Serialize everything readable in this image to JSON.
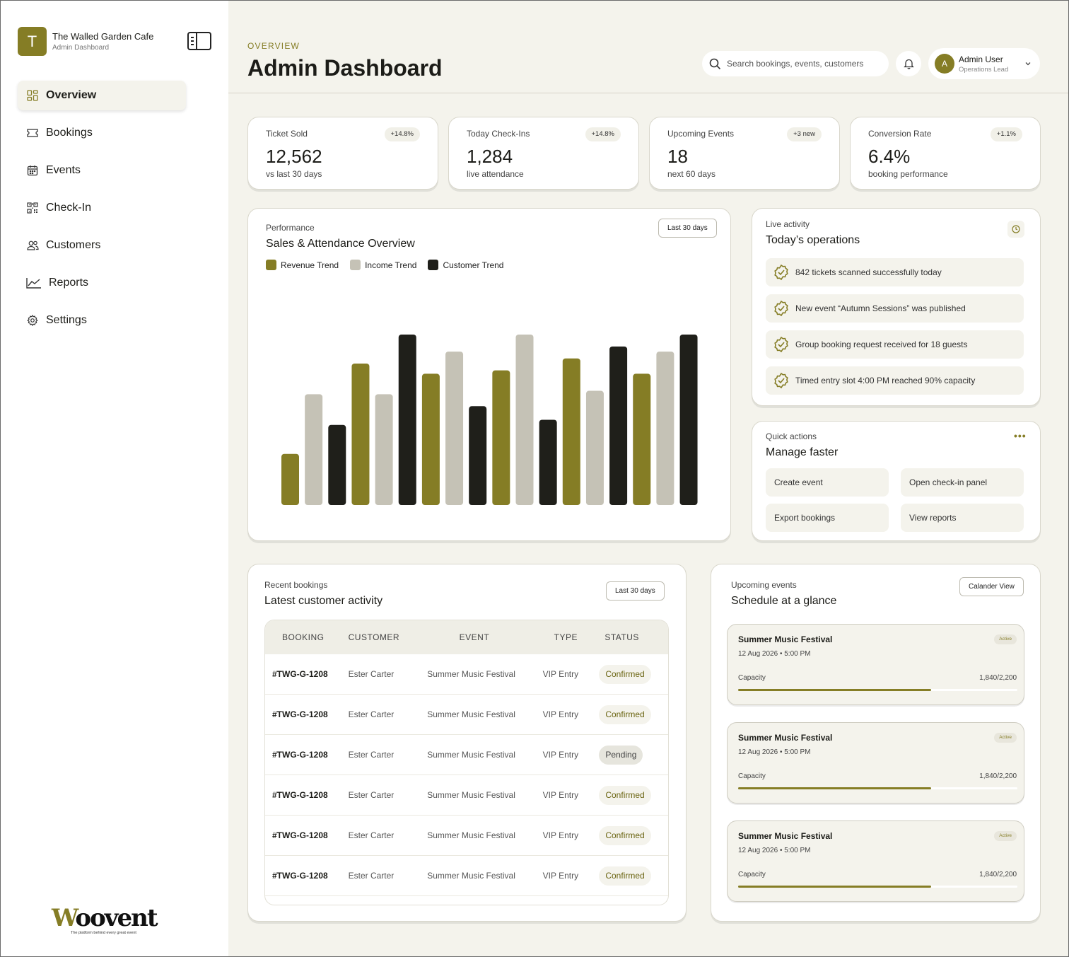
{
  "brand": {
    "initial": "T",
    "name": "The Walled Garden Cafe",
    "subtitle": "Admin Dashboard"
  },
  "sidebar": {
    "items": [
      {
        "label": "Overview",
        "icon": "grid-icon",
        "active": true
      },
      {
        "label": "Bookings",
        "icon": "ticket-icon"
      },
      {
        "label": "Events",
        "icon": "calendar-icon"
      },
      {
        "label": "Check-In",
        "icon": "qr-code-icon"
      },
      {
        "label": "Customers",
        "icon": "users-icon"
      },
      {
        "label": "Reports",
        "icon": "line-chart-icon"
      },
      {
        "label": "Settings",
        "icon": "gear-icon"
      }
    ],
    "footer_logo": {
      "word": "Woovent",
      "tagline": "The platform behind every great event"
    }
  },
  "header": {
    "eyebrow": "OVERVIEW",
    "title": "Admin Dashboard",
    "search_placeholder": "Search bookings, events, customers",
    "user": {
      "initial": "A",
      "name": "Admin User",
      "role": "Operations Lead"
    }
  },
  "stats": [
    {
      "label": "Ticket Sold",
      "badge": "+14.8%",
      "value": "12,562",
      "sub": "vs last 30 days"
    },
    {
      "label": "Today Check-Ins",
      "badge": "+14.8%",
      "value": "1,284",
      "sub": "live attendance"
    },
    {
      "label": "Upcoming Events",
      "badge": "+3 new",
      "value": "18",
      "sub": "next 60 days"
    },
    {
      "label": "Conversion Rate",
      "badge": "+1.1%",
      "value": "6.4%",
      "sub": "booking performance"
    }
  ],
  "performance": {
    "label": "Performance",
    "title": "Sales & Attendance Overview",
    "range_button": "Last 30 days"
  },
  "chart_data": {
    "type": "bar",
    "grid": false,
    "ylim": [
      0,
      100
    ],
    "legend_position": "top-left",
    "series": [
      {
        "name": "Revenue Trend",
        "color": "#857d25"
      },
      {
        "name": "Income Trend",
        "color": "#c5c2b6"
      },
      {
        "name": "Customer Trend",
        "color": "#1f1f1a"
      }
    ],
    "bars": [
      {
        "series": 0,
        "value": 30
      },
      {
        "series": 1,
        "value": 65
      },
      {
        "series": 2,
        "value": 47
      },
      {
        "series": 0,
        "value": 83
      },
      {
        "series": 1,
        "value": 65
      },
      {
        "series": 2,
        "value": 100
      },
      {
        "series": 0,
        "value": 77
      },
      {
        "series": 1,
        "value": 90
      },
      {
        "series": 2,
        "value": 58
      },
      {
        "series": 0,
        "value": 79
      },
      {
        "series": 1,
        "value": 100
      },
      {
        "series": 2,
        "value": 50
      },
      {
        "series": 0,
        "value": 86
      },
      {
        "series": 1,
        "value": 67
      },
      {
        "series": 2,
        "value": 93
      },
      {
        "series": 0,
        "value": 77
      },
      {
        "series": 1,
        "value": 90
      },
      {
        "series": 2,
        "value": 100
      }
    ]
  },
  "live_activity": {
    "label": "Live activity",
    "title": "Today’s operations",
    "items": [
      "842 tickets scanned successfully today",
      "New event “Autumn Sessions” was published",
      "Group booking request received for 18 guests",
      "Timed entry slot 4:00 PM reached 90% capacity"
    ]
  },
  "quick_actions": {
    "label": "Quick actions",
    "title": "Manage faster",
    "actions": [
      "Create event",
      "Open check-in panel",
      "Export bookings",
      "View reports"
    ]
  },
  "recent_bookings": {
    "label": "Recent bookings",
    "title": "Latest customer activity",
    "range_button": "Last 30 days",
    "columns": [
      "BOOKING",
      "CUSTOMER",
      "EVENT",
      "TYPE",
      "STATUS"
    ],
    "rows": [
      [
        "#TWG-G-1208",
        "Ester Carter",
        "Summer Music Festival",
        "VIP Entry",
        "Confirmed"
      ],
      [
        "#TWG-G-1208",
        "Ester Carter",
        "Summer Music Festival",
        "VIP Entry",
        "Confirmed"
      ],
      [
        "#TWG-G-1208",
        "Ester Carter",
        "Summer Music Festival",
        "VIP Entry",
        "Pending"
      ],
      [
        "#TWG-G-1208",
        "Ester Carter",
        "Summer Music Festival",
        "VIP Entry",
        "Confirmed"
      ],
      [
        "#TWG-G-1208",
        "Ester Carter",
        "Summer Music Festival",
        "VIP Entry",
        "Confirmed"
      ],
      [
        "#TWG-G-1208",
        "Ester Carter",
        "Summer Music Festival",
        "VIP Entry",
        "Confirmed"
      ]
    ]
  },
  "upcoming_events": {
    "label": "Upcoming events",
    "title": "Schedule at a glance",
    "view_button": "Calander View",
    "events": [
      {
        "title": "Summer Music Festival",
        "date": "12 Aug 2026 • 5:00 PM",
        "badge": "Active",
        "capacity_label": "Capacity",
        "capacity": "1,840/2,200",
        "fill": 0.69
      },
      {
        "title": "Summer Music Festival",
        "date": "12 Aug 2026 • 5:00 PM",
        "badge": "Active",
        "capacity_label": "Capacity",
        "capacity": "1,840/2,200",
        "fill": 0.69
      },
      {
        "title": "Summer Music Festival",
        "date": "12 Aug 2026 • 5:00 PM",
        "badge": "Active",
        "capacity_label": "Capacity",
        "capacity": "1,840/2,200",
        "fill": 0.69
      }
    ]
  },
  "colors": {
    "accent": "#857d25",
    "background": "#f4f3ec",
    "dark": "#1f1f1a",
    "light": "#c5c2b6"
  }
}
